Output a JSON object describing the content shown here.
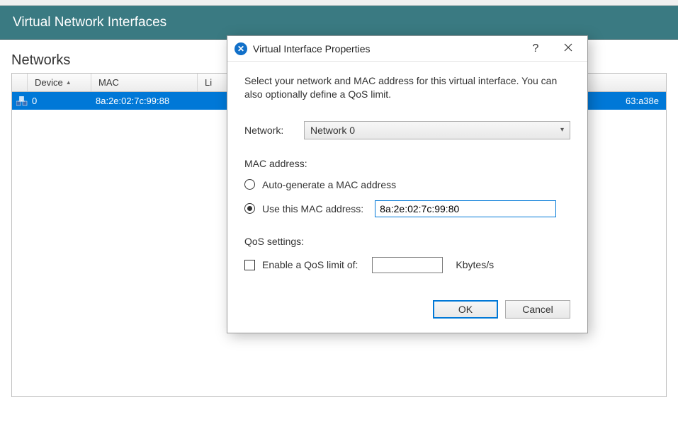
{
  "header": {
    "title": "Virtual Network Interfaces"
  },
  "section": {
    "title": "Networks"
  },
  "table": {
    "columns": {
      "device": "Device",
      "mac": "MAC",
      "link": "Li"
    },
    "rows": [
      {
        "device": "0",
        "mac": "8a:2e:02:7c:99:88",
        "link_suffix": "63:a38e"
      }
    ]
  },
  "dialog": {
    "title": "Virtual Interface Properties",
    "help": "?",
    "intro": "Select your network and MAC address for this virtual interface. You can also optionally define a QoS limit.",
    "network_label": "Network:",
    "network_value": "Network 0",
    "mac_group": "MAC address:",
    "radio_auto": "Auto-generate a MAC address",
    "radio_use": "Use this MAC address:",
    "mac_value": "8a:2e:02:7c:99:80",
    "qos_group": "QoS settings:",
    "qos_checkbox": "Enable a QoS limit of:",
    "qos_value": "",
    "qos_unit": "Kbytes/s",
    "ok": "OK",
    "cancel": "Cancel"
  }
}
